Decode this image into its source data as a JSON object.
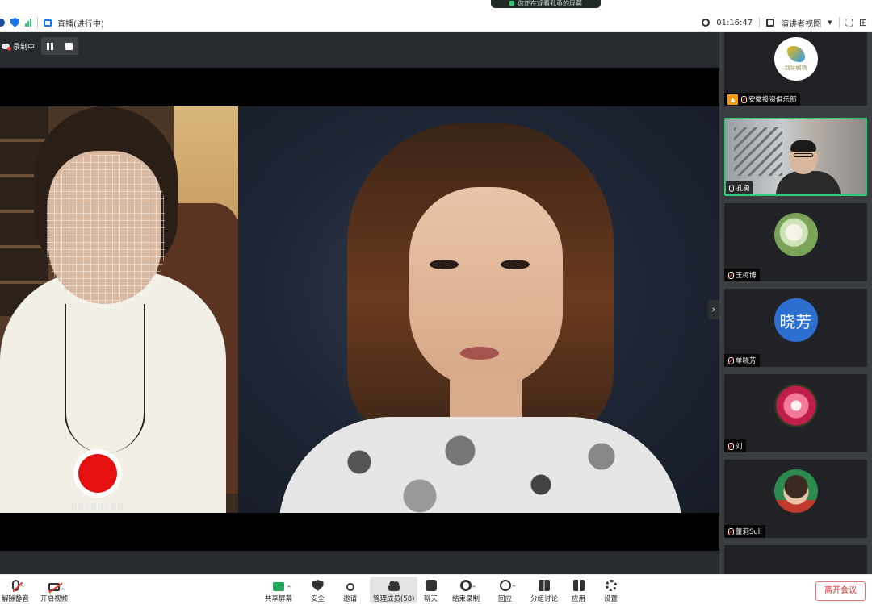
{
  "top_bar": {
    "share_notice": "您正在观看孔勇的屏幕",
    "live_label": "直播(进行中)",
    "timer": "01:16:47",
    "view_mode": "演讲者视图"
  },
  "recording": {
    "label": "录制中",
    "timecode": "00:00:00"
  },
  "participants": [
    {
      "name": "安徽投资俱乐部",
      "thumb_text": "剑芽剧场",
      "role": "host",
      "muted": true
    },
    {
      "name": "孔勇",
      "muted": false,
      "speaking": true
    },
    {
      "name": "王柯博",
      "muted": true
    },
    {
      "name": "单晓芳",
      "thumb_text": "晓芳",
      "muted": true
    },
    {
      "name": "刘",
      "muted": true
    },
    {
      "name": "董莉Suli",
      "muted": true
    }
  ],
  "toolbar": {
    "mute": "解除静音",
    "video": "开启视频",
    "share": "共享屏幕",
    "security": "安全",
    "invite": "邀请",
    "members": "管理成员(58)",
    "chat": "聊天",
    "end_record": "结束录制",
    "react": "回应",
    "breakout": "分组讨论",
    "apps": "应用",
    "settings": "设置",
    "leave": "离开会议"
  },
  "colors": {
    "accent_green": "#2ecc71",
    "record_red": "#e51010",
    "leave_red": "#d32f2f",
    "stage_bg": "#272a2e"
  }
}
